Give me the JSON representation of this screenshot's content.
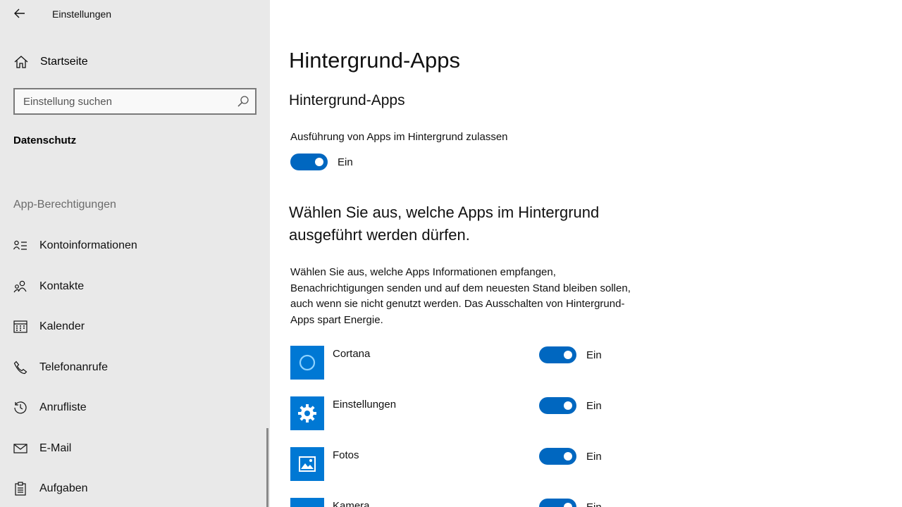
{
  "window": {
    "title": "Einstellungen"
  },
  "sidebar": {
    "home_label": "Startseite",
    "search_placeholder": "Einstellung suchen",
    "section_title": "Datenschutz",
    "group_label": "App-Berechtigungen",
    "items": [
      {
        "label": "Kontoinformationen",
        "icon": "account-info-icon"
      },
      {
        "label": "Kontakte",
        "icon": "contacts-icon"
      },
      {
        "label": "Kalender",
        "icon": "calendar-icon"
      },
      {
        "label": "Telefonanrufe",
        "icon": "phone-icon"
      },
      {
        "label": "Anrufliste",
        "icon": "history-icon"
      },
      {
        "label": "E-Mail",
        "icon": "mail-icon"
      },
      {
        "label": "Aufgaben",
        "icon": "tasks-icon"
      }
    ]
  },
  "main": {
    "page_title": "Hintergrund-Apps",
    "subhead": "Hintergrund-Apps",
    "master_toggle": {
      "description": "Ausführung von Apps im Hintergrund zulassen",
      "state": "Ein"
    },
    "heading2_line1": "Wählen Sie aus, welche Apps im Hintergrund",
    "heading2_line2": "ausgeführt werden dürfen.",
    "description_lines": [
      "Wählen Sie aus, welche Apps Informationen empfangen,",
      "Benachrichtigungen senden und auf dem neuesten Stand bleiben sollen,",
      "auch wenn sie nicht genutzt werden. Das Ausschalten von Hintergrund-",
      "Apps spart Energie."
    ],
    "apps": [
      {
        "name": "Cortana",
        "state": "Ein",
        "icon": "cortana-icon"
      },
      {
        "name": "Einstellungen",
        "state": "Ein",
        "icon": "settings-gear-icon"
      },
      {
        "name": "Fotos",
        "state": "Ein",
        "icon": "photos-icon"
      },
      {
        "name": "Kamera",
        "state": "Ein",
        "icon": "camera-icon"
      }
    ]
  },
  "colors": {
    "accent": "#0067c0",
    "app_tile": "#0078d4",
    "sidebar_bg": "#e9e9e9"
  }
}
